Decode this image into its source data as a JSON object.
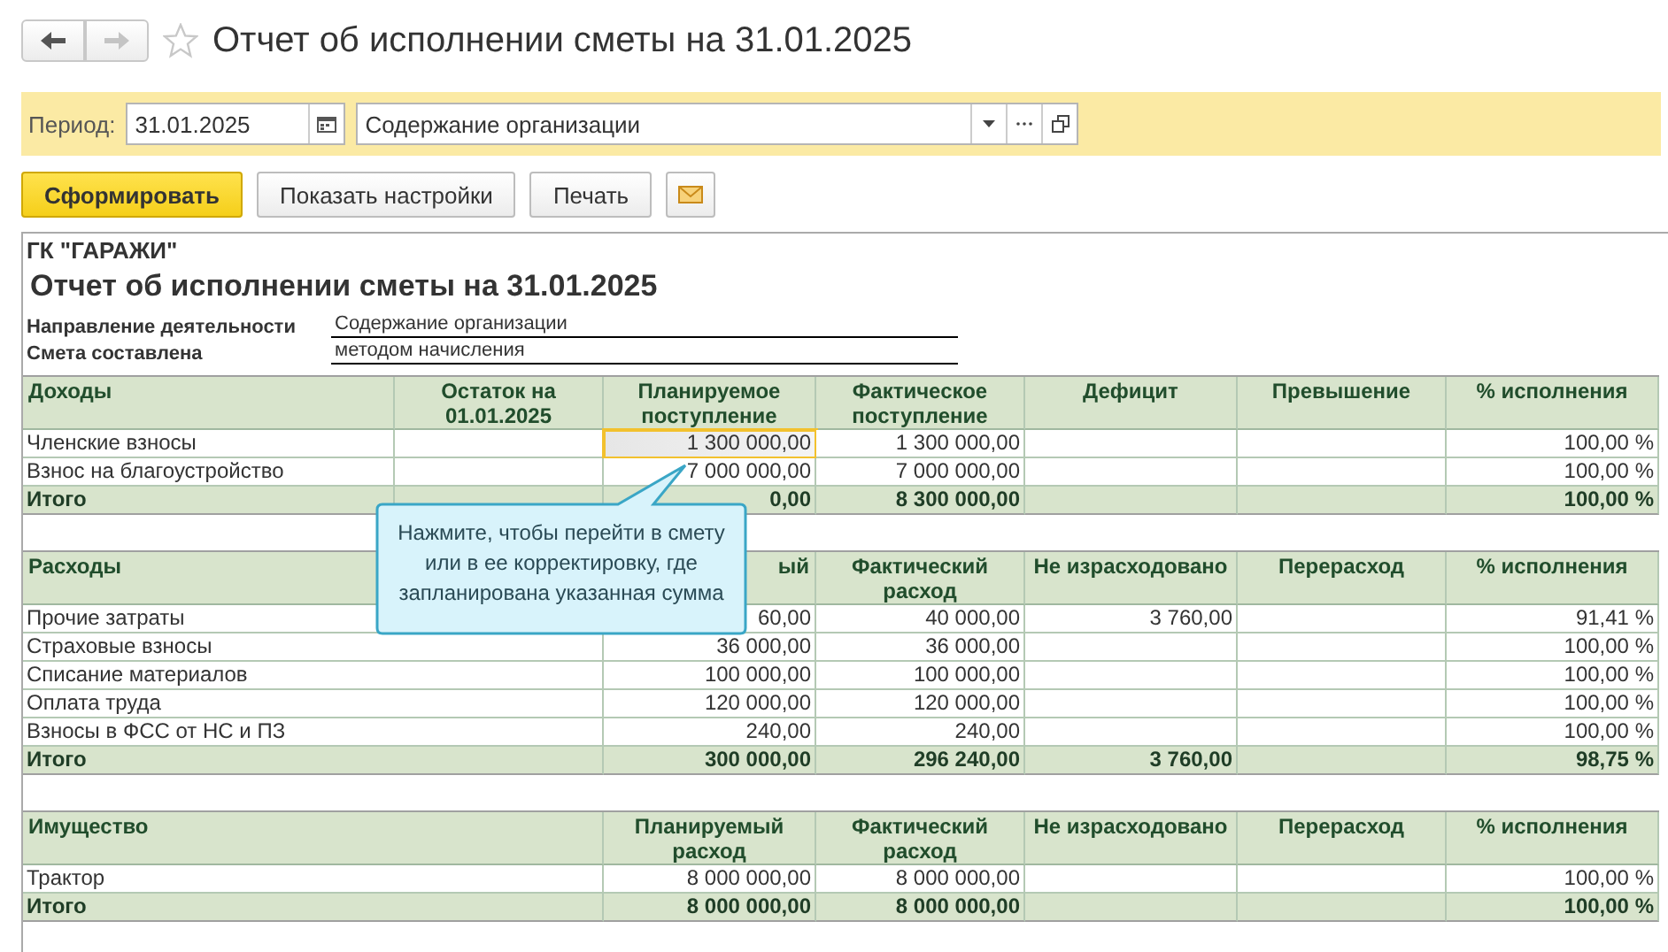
{
  "nav": {
    "back_enabled": true,
    "forward_enabled": false,
    "favorite": false
  },
  "window": {
    "title": "Отчет об исполнении сметы на 31.01.2025"
  },
  "filters": {
    "label": "Период:",
    "period": "31.01.2025",
    "activity": "Содержание организации"
  },
  "buttons": [
    {
      "kind": "primary",
      "label": "Сформировать"
    },
    {
      "kind": "default",
      "label": "Показать настройки"
    },
    {
      "kind": "default",
      "label": "Печать"
    },
    {
      "kind": "mail"
    }
  ],
  "report": {
    "organization": "ГК \"ГАРАЖИ\"",
    "title": "Отчет об исполнении сметы на 31.01.2025",
    "params": [
      {
        "label": "Направление деятельности",
        "value": "Содержание организации"
      },
      {
        "label": "Смета составлена",
        "value": "методом начисления"
      }
    ],
    "sections": [
      {
        "kind": "income",
        "columns": [
          "Доходы",
          "Остаток на 01.01.2025",
          "Планируемое поступление",
          "Фактическое поступление",
          "Дефицит",
          "Превышение",
          "% исполнения"
        ],
        "rows": [
          {
            "total": false,
            "selected": true,
            "cells": [
              "Членские взносы",
              null,
              "1 300 000,00",
              "1 300 000,00",
              null,
              null,
              "100,00 %"
            ]
          },
          {
            "total": false,
            "selected": false,
            "cells": [
              "Взнос на благоустройство",
              null,
              "7 000 000,00",
              "7 000 000,00",
              null,
              null,
              "100,00 %"
            ]
          },
          {
            "total": true,
            "selected": false,
            "cells": [
              "Итого",
              null,
              "0,00",
              "8 300 000,00",
              null,
              null,
              "100,00 %"
            ]
          }
        ]
      },
      {
        "kind": "expense",
        "header_cut": true,
        "columns": [
          "Расходы",
          "ый",
          "Фактический расход",
          "Не израсходовано",
          "Перерасход",
          "% исполнения"
        ],
        "rows": [
          {
            "total": false,
            "selected": false,
            "cells": [
              "Прочие затраты",
              "60,00",
              "40 000,00",
              "3 760,00",
              null,
              "91,41 %"
            ]
          },
          {
            "total": false,
            "selected": false,
            "cells": [
              "Страховые взносы",
              "36 000,00",
              "36 000,00",
              null,
              null,
              "100,00 %"
            ]
          },
          {
            "total": false,
            "selected": false,
            "cells": [
              "Списание материалов",
              "100 000,00",
              "100 000,00",
              null,
              null,
              "100,00 %"
            ]
          },
          {
            "total": false,
            "selected": false,
            "cells": [
              "Оплата труда",
              "120 000,00",
              "120 000,00",
              null,
              null,
              "100,00 %"
            ]
          },
          {
            "total": false,
            "selected": false,
            "cells": [
              "Взносы в ФСС от НС и ПЗ",
              "240,00",
              "240,00",
              null,
              null,
              "100,00 %"
            ]
          },
          {
            "total": true,
            "selected": false,
            "cells": [
              "Итого",
              "300 000,00",
              "296 240,00",
              "3 760,00",
              null,
              "98,75 %"
            ]
          }
        ]
      },
      {
        "kind": "expense",
        "columns": [
          "Имущество",
          "Планируемый расход",
          "Фактический расход",
          "Не израсходовано",
          "Перерасход",
          "% исполнения"
        ],
        "rows": [
          {
            "total": false,
            "selected": false,
            "cells": [
              "Трактор",
              "8 000 000,00",
              "8 000 000,00",
              null,
              null,
              "100,00 %"
            ]
          },
          {
            "total": true,
            "selected": false,
            "cells": [
              "Итого",
              "8 000 000,00",
              "8 000 000,00",
              null,
              null,
              "100,00 %"
            ]
          }
        ]
      }
    ]
  },
  "tooltip": {
    "text": "Нажмите, чтобы перейти в смету\nили в ее корректировку, где\nзапланирована указанная сумма"
  }
}
